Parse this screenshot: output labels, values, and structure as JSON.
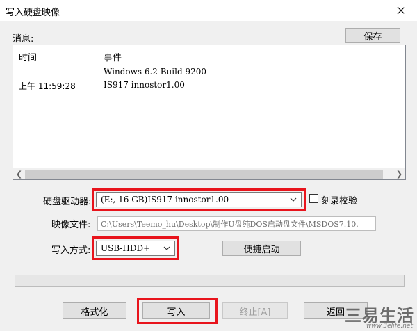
{
  "window": {
    "title": "写入硬盘映像",
    "close_glyph": "✕"
  },
  "messages": {
    "label": "消息:",
    "save_label": "保存",
    "columns": [
      "时间",
      "事件"
    ],
    "rows": [
      {
        "time": "",
        "event": "Windows 6.2 Build 9200"
      },
      {
        "time": "上午 11:59:28",
        "event": "IS917    innostor1.00"
      }
    ]
  },
  "drive": {
    "label": "硬盘驱动器:",
    "selected": "(E:, 16 GB)IS917    innostor1.00",
    "verify_label": "刻录校验",
    "verify_checked": false
  },
  "image_file": {
    "label": "映像文件:",
    "value": "C:\\Users\\Teemo_hu\\Desktop\\制作U盘纯DOS启动盘文件\\MSDOS7.10."
  },
  "write_mode": {
    "label": "写入方式:",
    "selected": "USB-HDD+",
    "quick_boot_label": "便捷启动"
  },
  "progress": {
    "value": 0
  },
  "actions": {
    "format_label": "格式化",
    "write_label": "写入",
    "stop_label": "终止[A]",
    "back_label": "返回"
  },
  "watermark": {
    "text": "三易生活",
    "url": "www.3elife.net"
  },
  "colors": {
    "highlight": "#e8141c",
    "dialog_bg": "#f0f0f0"
  }
}
